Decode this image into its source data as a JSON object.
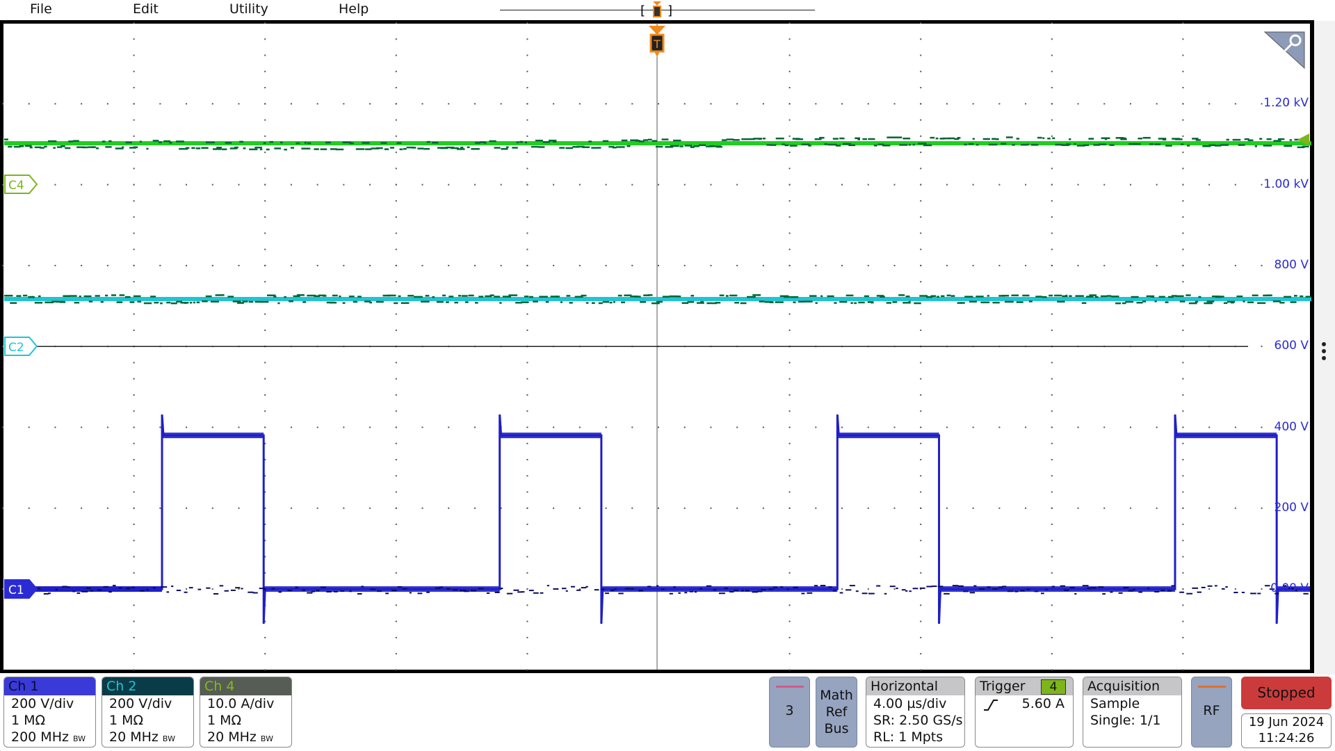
{
  "menu": [
    "File",
    "Edit",
    "Utility",
    "Help"
  ],
  "colors": {
    "ch1": "#1f1fc8",
    "ch2": "#20c4d4",
    "ch4": "#22cc22",
    "ch4_marker": "#7db51a",
    "trigger": "#f08a1c",
    "axis_label": "#2b2bd6",
    "stopped": "#cc3b3b"
  },
  "icons": {
    "zoom": "magnifier-icon",
    "more": "vertical-ellipsis-icon",
    "trigger_slope": "rising-edge-icon",
    "trigger_marker": "trigger-T-icon"
  },
  "trigger_marker_label": "T",
  "y_axis_labels": [
    "1.20 kV",
    "1.00 kV",
    "800 V",
    "600 V",
    "400 V",
    "200 V",
    "0.00 V"
  ],
  "channel_markers": {
    "c4": "C4",
    "c2": "C2",
    "c1": "C1"
  },
  "waveforms": {
    "time_per_div_us": 4.0,
    "ch1": {
      "low_v": 0,
      "high_v": 380,
      "rising_edges_us": [
        -15.1,
        -4.8,
        5.5,
        15.8
      ],
      "falling_edges_us": [
        -12.0,
        -1.7,
        8.6,
        18.9
      ]
    },
    "ch2": {
      "level_div_above_marker": 0.58
    },
    "ch4": {
      "level_div_above_marker": 0.5
    }
  },
  "channels": [
    {
      "name": "Ch 1",
      "scale": "200 V/div",
      "impedance": "1 MΩ",
      "bandwidth": "200 MHz",
      "bw_mark": "BW",
      "header_bg": "#3a3ad8",
      "header_fg": "#0a0a30"
    },
    {
      "name": "Ch 2",
      "scale": "200 V/div",
      "impedance": "1 MΩ",
      "bandwidth": "20 MHz",
      "bw_mark": "BW",
      "header_bg": "#0a3c48",
      "header_fg": "#20c4d4"
    },
    {
      "name": "Ch 4",
      "scale": "10.0 A/div",
      "impedance": "1 MΩ",
      "bandwidth": "20 MHz",
      "bw_mark": "BW",
      "header_bg": "#555d55",
      "header_fg": "#8ab81a"
    }
  ],
  "buttons": {
    "ch3": "3",
    "math": [
      "Math",
      "Ref",
      "Bus"
    ],
    "rf": "RF"
  },
  "horizontal": {
    "title": "Horizontal",
    "scale": "4.00 µs/div",
    "sr": "SR: 2.50 GS/s",
    "rl": "RL: 1 Mpts"
  },
  "trigger": {
    "title": "Trigger",
    "source": "4",
    "level": "5.60 A"
  },
  "acquisition": {
    "title": "Acquisition",
    "mode": "Sample",
    "count": "Single: 1/1"
  },
  "status": "Stopped",
  "date": "19 Jun 2024",
  "time": "11:24:26"
}
